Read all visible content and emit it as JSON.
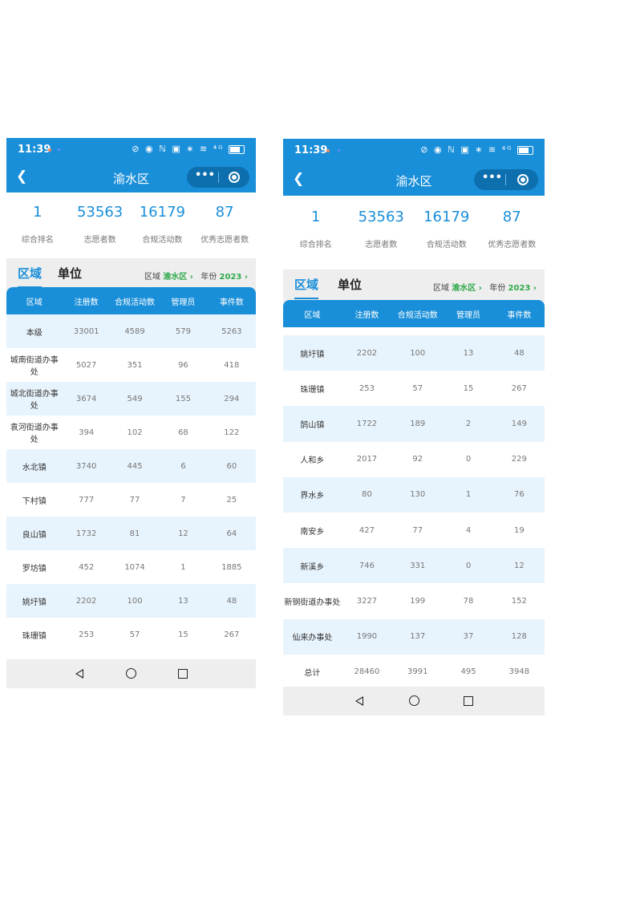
{
  "status": {
    "time": "11:39",
    "icons": "⊘ ◉ ℕ ▣ ∗ ≋ ⁴ᴳ"
  },
  "nav": {
    "title": "渝水区",
    "back_icon": "chevron-left",
    "more_label": "•••"
  },
  "stats": [
    {
      "value": "1",
      "label": "综合排名"
    },
    {
      "value": "53563",
      "label": "志愿者数"
    },
    {
      "value": "16179",
      "label": "合规活动数"
    },
    {
      "value": "87",
      "label": "优秀志愿者数"
    }
  ],
  "tabs": {
    "active": "区域",
    "inactive": "单位"
  },
  "filters": {
    "area_label": "区域",
    "area_value": "渝水区",
    "year_label": "年份",
    "year_value": "2023"
  },
  "table_header": [
    "区域",
    "注册数",
    "合规活动数",
    "管理员",
    "事件数"
  ],
  "screen1_rows": [
    [
      "本级",
      "33001",
      "4589",
      "579",
      "5263"
    ],
    [
      "城南街道办事处",
      "5027",
      "351",
      "96",
      "418"
    ],
    [
      "城北街道办事处",
      "3674",
      "549",
      "155",
      "294"
    ],
    [
      "袁河街道办事处",
      "394",
      "102",
      "68",
      "122"
    ],
    [
      "水北镇",
      "3740",
      "445",
      "6",
      "60"
    ],
    [
      "下村镇",
      "777",
      "77",
      "7",
      "25"
    ],
    [
      "良山镇",
      "1732",
      "81",
      "12",
      "64"
    ],
    [
      "罗坊镇",
      "452",
      "1074",
      "1",
      "1885"
    ],
    [
      "姚圩镇",
      "2202",
      "100",
      "13",
      "48"
    ],
    [
      "珠珊镇",
      "253",
      "57",
      "15",
      "267"
    ]
  ],
  "screen2_rows": [
    [
      "姚圩镇",
      "2202",
      "100",
      "13",
      "48"
    ],
    [
      "珠珊镇",
      "253",
      "57",
      "15",
      "267"
    ],
    [
      "鹄山镇",
      "1722",
      "189",
      "2",
      "149"
    ],
    [
      "人和乡",
      "2017",
      "92",
      "0",
      "229"
    ],
    [
      "界水乡",
      "80",
      "130",
      "1",
      "76"
    ],
    [
      "南安乡",
      "427",
      "77",
      "4",
      "19"
    ],
    [
      "新溪乡",
      "746",
      "331",
      "0",
      "12"
    ],
    [
      "新钢街道办事处",
      "3227",
      "199",
      "78",
      "152"
    ],
    [
      "仙来办事处",
      "1990",
      "137",
      "37",
      "128"
    ],
    [
      "总计",
      "28460",
      "3991",
      "495",
      "3948"
    ]
  ],
  "colors": {
    "primary": "#1a8fd9",
    "accent_green": "#2eaa4b",
    "row_alt": "#e8f4fd"
  }
}
